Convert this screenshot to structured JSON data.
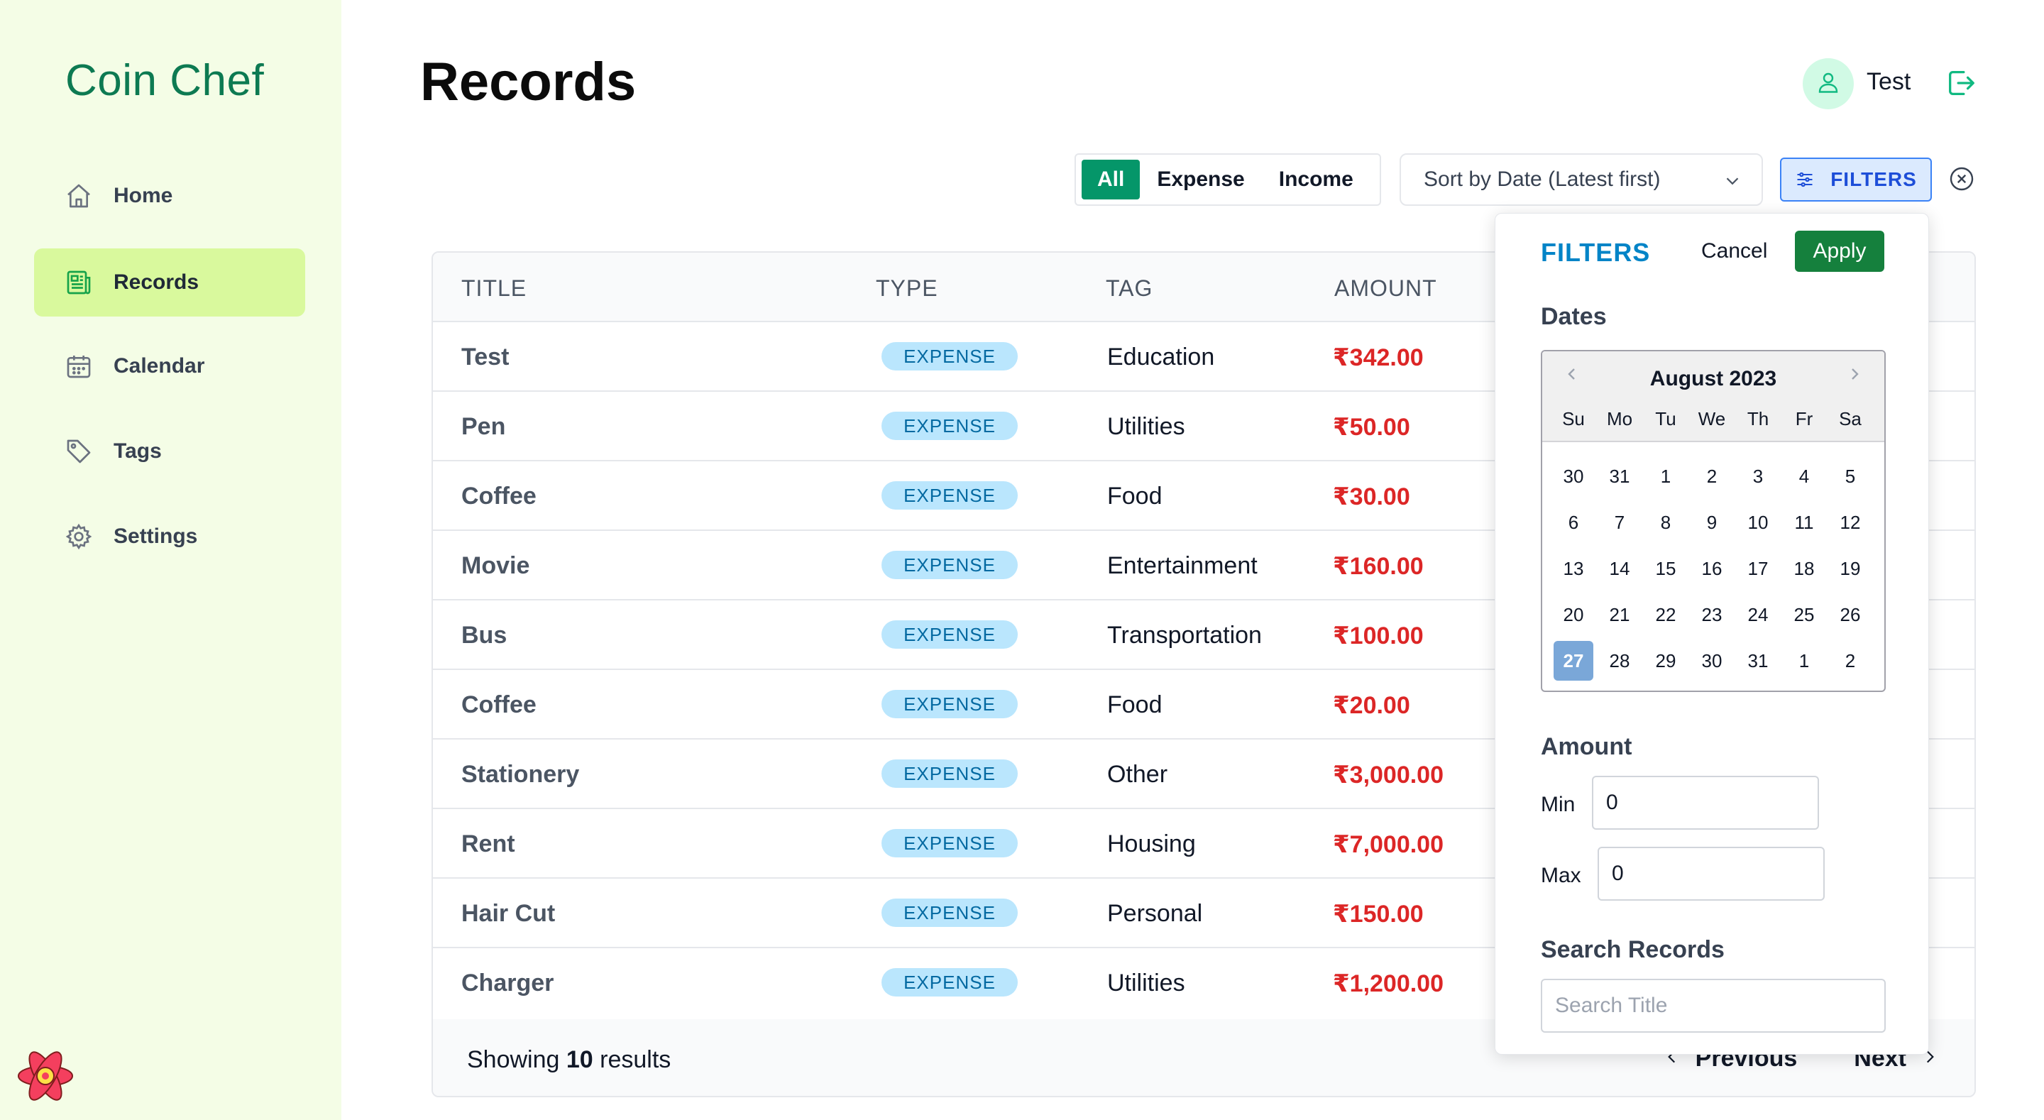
{
  "app": {
    "name": "Coin Chef"
  },
  "sidebar": {
    "items": [
      {
        "label": "Home",
        "icon": "home-icon",
        "active": false
      },
      {
        "label": "Records",
        "icon": "records-icon",
        "active": true
      },
      {
        "label": "Calendar",
        "icon": "calendar-icon",
        "active": false
      },
      {
        "label": "Tags",
        "icon": "tag-icon",
        "active": false
      },
      {
        "label": "Settings",
        "icon": "gear-icon",
        "active": false
      }
    ]
  },
  "header": {
    "title": "Records",
    "user_name": "Test"
  },
  "toolbar": {
    "type_tabs": [
      "All",
      "Expense",
      "Income"
    ],
    "active_type": "All",
    "sort_value": "Sort by Date (Latest first)",
    "filters_label": "FILTERS"
  },
  "table": {
    "columns": [
      "TITLE",
      "TYPE",
      "TAG",
      "AMOUNT"
    ],
    "rows": [
      {
        "title": "Test",
        "type": "EXPENSE",
        "tag": "Education",
        "amount": "₹342.00"
      },
      {
        "title": "Pen",
        "type": "EXPENSE",
        "tag": "Utilities",
        "amount": "₹50.00"
      },
      {
        "title": "Coffee",
        "type": "EXPENSE",
        "tag": "Food",
        "amount": "₹30.00"
      },
      {
        "title": "Movie",
        "type": "EXPENSE",
        "tag": "Entertainment",
        "amount": "₹160.00"
      },
      {
        "title": "Bus",
        "type": "EXPENSE",
        "tag": "Transportation",
        "amount": "₹100.00"
      },
      {
        "title": "Coffee",
        "type": "EXPENSE",
        "tag": "Food",
        "amount": "₹20.00"
      },
      {
        "title": "Stationery",
        "type": "EXPENSE",
        "tag": "Other",
        "amount": "₹3,000.00"
      },
      {
        "title": "Rent",
        "type": "EXPENSE",
        "tag": "Housing",
        "amount": "₹7,000.00"
      },
      {
        "title": "Hair Cut",
        "type": "EXPENSE",
        "tag": "Personal",
        "amount": "₹150.00"
      },
      {
        "title": "Charger",
        "type": "EXPENSE",
        "tag": "Utilities",
        "amount": "₹1,200.00"
      }
    ],
    "footer": {
      "showing_prefix": "Showing",
      "count": "10",
      "showing_suffix": "results",
      "previous": "Previous",
      "next": "Next"
    }
  },
  "filters_panel": {
    "title": "FILTERS",
    "cancel": "Cancel",
    "apply": "Apply",
    "dates_label": "Dates",
    "calendar": {
      "month": "August 2023",
      "weekdays": [
        "Su",
        "Mo",
        "Tu",
        "We",
        "Th",
        "Fr",
        "Sa"
      ],
      "weeks": [
        [
          "30",
          "31",
          "1",
          "2",
          "3",
          "4",
          "5"
        ],
        [
          "6",
          "7",
          "8",
          "9",
          "10",
          "11",
          "12"
        ],
        [
          "13",
          "14",
          "15",
          "16",
          "17",
          "18",
          "19"
        ],
        [
          "20",
          "21",
          "22",
          "23",
          "24",
          "25",
          "26"
        ],
        [
          "27",
          "28",
          "29",
          "30",
          "31",
          "1",
          "2"
        ]
      ],
      "selected": "27"
    },
    "amount_label": "Amount",
    "min_label": "Min",
    "min_value": "0",
    "max_label": "Max",
    "max_value": "0",
    "search_label": "Search Records",
    "search_placeholder": "Search Title"
  },
  "colors": {
    "brand": "#0d7a52",
    "sidebar_bg": "#f4fde6",
    "active_nav": "#d9f99d",
    "expense_amount": "#dc2626",
    "badge_bg": "#bae6fd",
    "apply_bg": "#15803d",
    "filters_accent": "#0284c7"
  }
}
